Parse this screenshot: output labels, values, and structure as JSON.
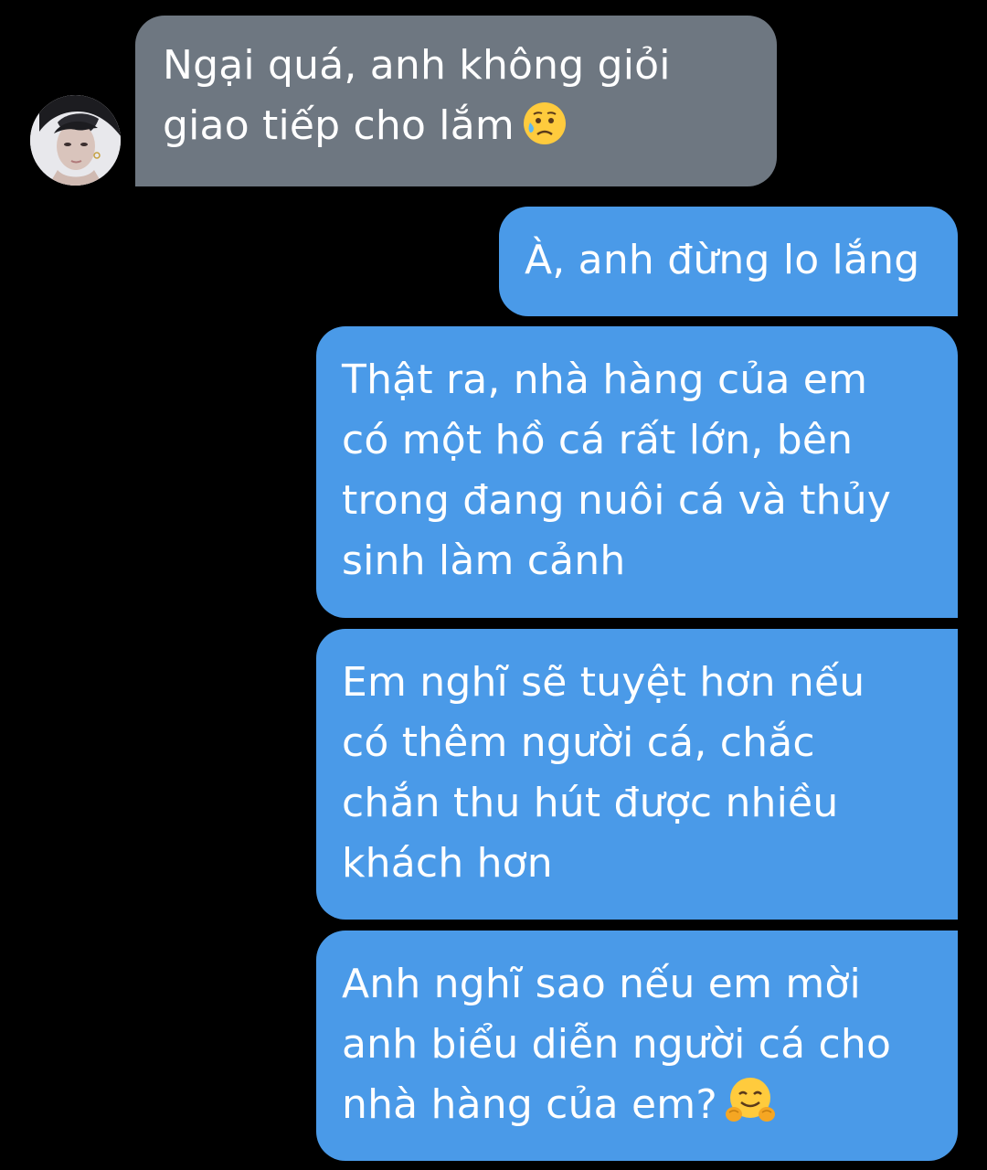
{
  "conversation": {
    "contact": {
      "avatar_icon": "contact-avatar"
    },
    "messages": [
      {
        "direction": "incoming",
        "text": "Ngại quá, anh không giỏi\ngiao tiếp cho lắm",
        "emoji": "sad-but-relieved-face-icon"
      },
      {
        "direction": "outgoing",
        "text": "À, anh đừng lo lắng"
      },
      {
        "direction": "outgoing",
        "text": "Thật ra, nhà hàng của em\ncó một hồ cá rất lớn, bên\ntrong đang nuôi cá và thủy\nsinh làm cảnh"
      },
      {
        "direction": "outgoing",
        "text": "Em nghĩ sẽ tuyệt hơn nếu\ncó thêm người cá, chắc\nchắn thu hút được nhiều\nkhách hơn"
      },
      {
        "direction": "outgoing",
        "text": "Anh nghĩ sao nếu em mời\nanh biểu diễn người cá cho\nnhà hàng của em?",
        "emoji": "hugging-face-icon"
      }
    ]
  },
  "colors": {
    "background": "#000000",
    "incoming_bubble": "#6e7781",
    "outgoing_bubble": "#4a9ae8",
    "text": "#ffffff"
  }
}
